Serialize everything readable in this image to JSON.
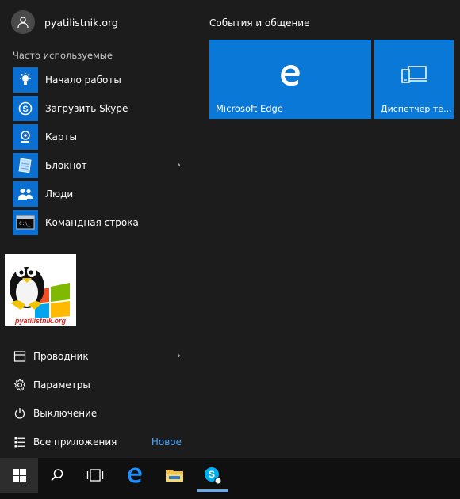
{
  "user": {
    "name": "pyatilistnik.org",
    "icon": "user-avatar-icon"
  },
  "frequent_label": "Часто используемые",
  "apps": [
    {
      "label": "Начало работы",
      "icon": "lightbulb-icon",
      "has_arrow": false
    },
    {
      "label": "Загрузить Skype",
      "icon": "skype-icon",
      "has_arrow": false
    },
    {
      "label": "Карты",
      "icon": "maps-icon",
      "has_arrow": false
    },
    {
      "label": "Блокнот",
      "icon": "notepad-icon",
      "has_arrow": true
    },
    {
      "label": "Люди",
      "icon": "people-icon",
      "has_arrow": false
    },
    {
      "label": "Командная строка",
      "icon": "cmd-icon",
      "has_arrow": false
    }
  ],
  "logo_text": "pyatilistnik.org",
  "system": [
    {
      "label": "Проводник",
      "icon": "explorer-icon",
      "has_arrow": true
    },
    {
      "label": "Параметры",
      "icon": "gear-icon",
      "has_arrow": false
    },
    {
      "label": "Выключение",
      "icon": "power-icon",
      "has_arrow": false
    },
    {
      "label": "Все приложения",
      "icon": "all-apps-icon",
      "badge": "Новое"
    }
  ],
  "tiles_group_title": "События и общение",
  "tiles": [
    {
      "label": "Microsoft Edge",
      "icon": "edge-icon"
    },
    {
      "label": "Диспетчер те...",
      "icon": "device-manager-icon"
    }
  ],
  "colors": {
    "accent": "#0a78d7",
    "background": "#1c1c1c",
    "taskbar": "#101010",
    "badge": "#4aa3ff"
  },
  "taskbar": [
    {
      "name": "start-button",
      "icon": "windows-logo-icon"
    },
    {
      "name": "search-button",
      "icon": "search-icon"
    },
    {
      "name": "task-view-button",
      "icon": "task-view-icon"
    },
    {
      "name": "edge-taskbar-button",
      "icon": "edge-icon"
    },
    {
      "name": "file-explorer-taskbar-button",
      "icon": "folder-icon"
    },
    {
      "name": "skype-taskbar-button",
      "icon": "skype-icon"
    }
  ]
}
